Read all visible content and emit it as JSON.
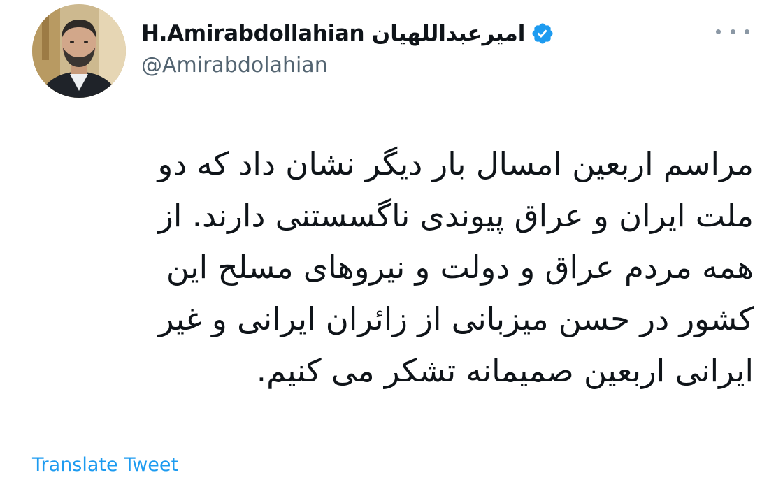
{
  "author": {
    "display_name": "H.Amirabdollahian امیرعبداللهیان",
    "handle": "@Amirabdolahian",
    "verified_icon": "verified-badge-icon",
    "avatar_icon": "profile-photo"
  },
  "header": {
    "more_icon": "more-options-icon"
  },
  "tweet": {
    "lines": [
      "مراسم اربعین امسال بار دیگر نشان داد که دو",
      "ملت ایران و عراق پیوندی ناگسستنی دارند. از",
      "همه مردم عراق و دولت و نیروهای مسلح این",
      "کشور در حسن میزبانی از زائران ایرانی و غیر",
      "ایرانی اربعین صمیمانه تشکر می کنیم."
    ]
  },
  "footer": {
    "translate_label": "Translate Tweet"
  },
  "colors": {
    "text": "#0f1419",
    "secondary": "#536471",
    "accent": "#1d9bf0"
  }
}
